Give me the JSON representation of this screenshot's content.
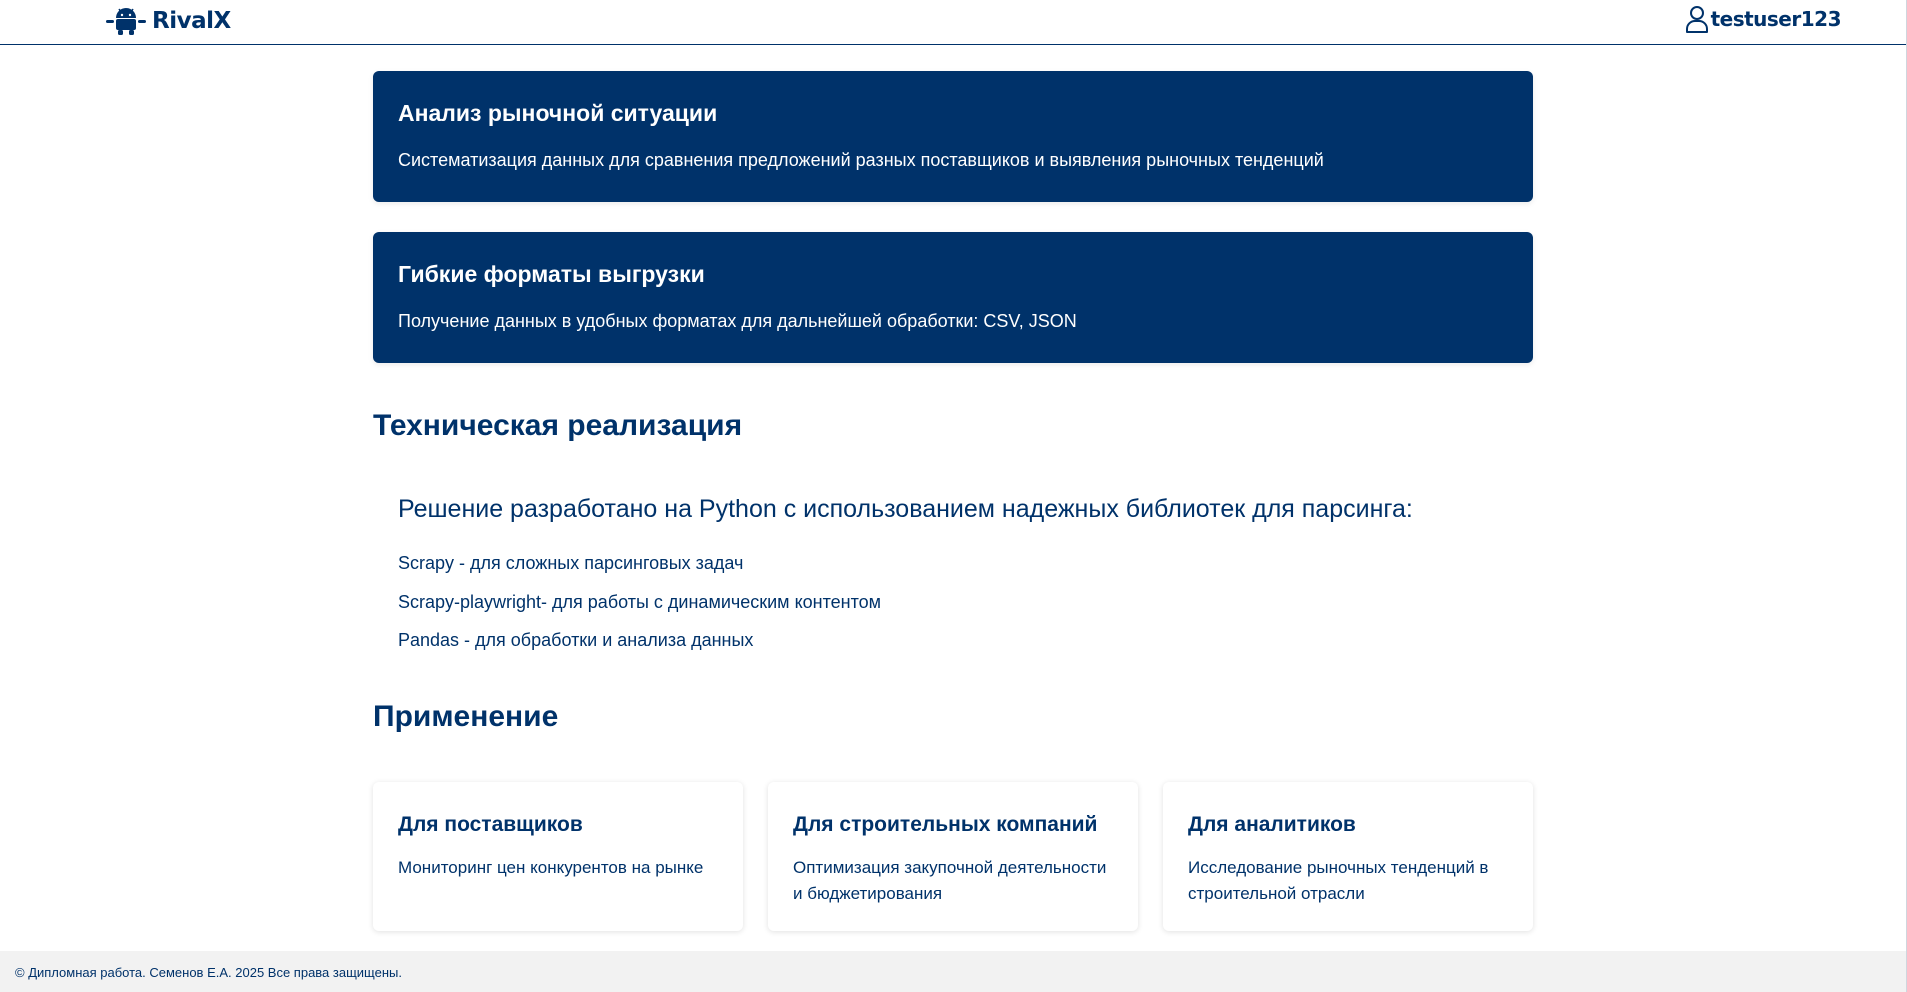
{
  "header": {
    "logo_text": "RivalX",
    "username": "testuser123"
  },
  "features": [
    {
      "title": "Анализ рыночной ситуации",
      "text": "Систематизация данных для сравнения предложений разных поставщиков и выявления рыночных тенденций"
    },
    {
      "title": "Гибкие форматы выгрузки",
      "text": "Получение данных в удобных форматах для дальнейшей обработки: CSV, JSON"
    }
  ],
  "tech": {
    "title": "Техническая реализация",
    "intro": "Решение разработано на Python с использованием надежных библиотек для парсинга:",
    "items": [
      "Scrapy - для сложных парсинговых задач",
      "Scrapy-playwright- для работы с динамическим контентом",
      "Pandas - для обработки и анализа данных"
    ]
  },
  "applications": {
    "title": "Применение",
    "cards": [
      {
        "title": "Для поставщиков",
        "text": "Мониторинг цен конкурентов на рынке"
      },
      {
        "title": "Для строительных компаний",
        "text": "Оптимизация закупочной деятельности и бюджетирования"
      },
      {
        "title": "Для аналитиков",
        "text": "Исследование рыночных тенденций в строительной отрасли"
      }
    ]
  },
  "footer": {
    "text": "© Дипломная работа. Семенов Е.А. 2025 Все права защищены."
  },
  "icons": {
    "logo": "robot-icon",
    "user": "user-icon"
  },
  "colors": {
    "primary": "#00326a",
    "footer_bg": "#f2f2f2",
    "background": "#ffffff"
  }
}
